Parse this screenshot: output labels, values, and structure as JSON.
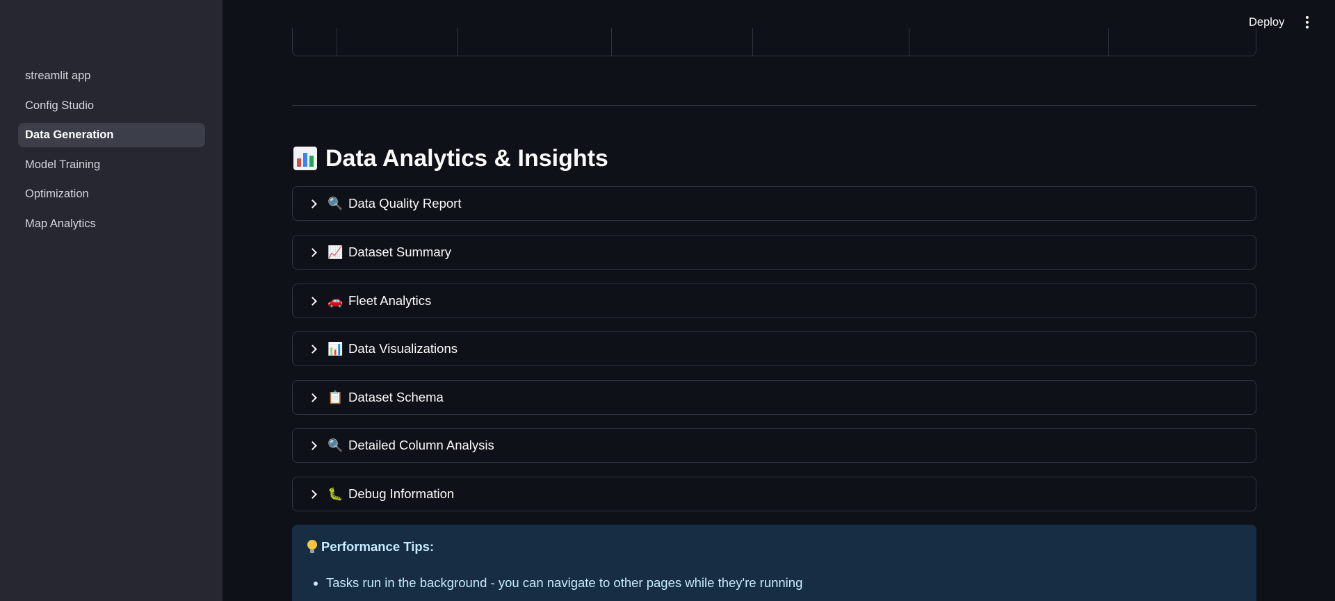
{
  "sidebar": {
    "items": [
      {
        "label": "streamlit app",
        "active": false
      },
      {
        "label": "Config Studio",
        "active": false
      },
      {
        "label": "Data Generation",
        "active": true
      },
      {
        "label": "Model Training",
        "active": false
      },
      {
        "label": "Optimization",
        "active": false
      },
      {
        "label": "Map Analytics",
        "active": false
      }
    ]
  },
  "header": {
    "deploy_label": "Deploy",
    "menu_icon": "kebab-menu-icon"
  },
  "main": {
    "section_title": "Data Analytics & Insights",
    "section_icon": "bar-chart-emoji",
    "expanders": [
      {
        "icon": "🔍",
        "icon_name": "magnifier-icon",
        "label": "Data Quality Report"
      },
      {
        "icon": "📈",
        "icon_name": "chart-increasing-icon",
        "label": "Dataset Summary"
      },
      {
        "icon": "🚗",
        "icon_name": "car-icon",
        "label": "Fleet Analytics"
      },
      {
        "icon": "📊",
        "icon_name": "bar-chart-icon",
        "label": "Data Visualizations"
      },
      {
        "icon": "📋",
        "icon_name": "clipboard-icon",
        "label": "Dataset Schema"
      },
      {
        "icon": "🔍",
        "icon_name": "magnifier-icon",
        "label": "Detailed Column Analysis"
      },
      {
        "icon": "🐛",
        "icon_name": "bug-icon",
        "label": "Debug Information"
      }
    ],
    "tips": {
      "title": "Performance Tips:",
      "icon": "light-bulb-icon",
      "items": [
        "Tasks run in the background - you can navigate to other pages while they're running"
      ]
    }
  },
  "colors": {
    "background": "#0e1117",
    "sidebar": "#262730",
    "active_nav": "#3c3e49",
    "info_box": "#172d43",
    "info_text": "#c7ebff"
  }
}
